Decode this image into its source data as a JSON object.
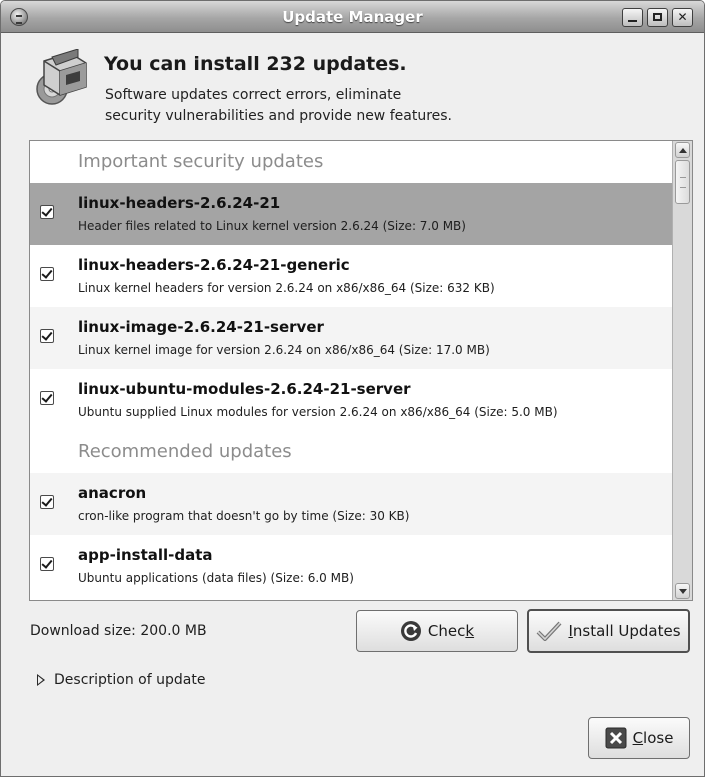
{
  "window": {
    "title": "Update Manager"
  },
  "header": {
    "headline": "You can install 232 updates.",
    "subline_1": "Software updates correct errors, eliminate",
    "subline_2": "security vulnerabilities and provide new features."
  },
  "updates": {
    "sections": [
      {
        "title": "Important security updates",
        "items": [
          {
            "name": "linux-headers-2.6.24-21",
            "description": "Header files related to Linux kernel version 2.6.24 (Size: 7.0 MB)",
            "checked": true,
            "selected": true
          },
          {
            "name": "linux-headers-2.6.24-21-generic",
            "description": "Linux kernel headers for version 2.6.24 on x86/x86_64 (Size: 632 KB)",
            "checked": true
          },
          {
            "name": "linux-image-2.6.24-21-server",
            "description": "Linux kernel image for version 2.6.24 on x86/x86_64 (Size: 17.0 MB)",
            "checked": true
          },
          {
            "name": "linux-ubuntu-modules-2.6.24-21-server",
            "description": "Ubuntu supplied Linux modules for version 2.6.24 on x86/x86_64 (Size: 5.0 MB)",
            "checked": true
          }
        ]
      },
      {
        "title": "Recommended updates",
        "items": [
          {
            "name": "anacron",
            "description": "cron-like program that doesn't go by time (Size: 30 KB)",
            "checked": true
          },
          {
            "name": "app-install-data",
            "description": "Ubuntu applications (data files) (Size: 6.0 MB)",
            "checked": true
          }
        ]
      }
    ]
  },
  "footer": {
    "download_size": "Download size: 200.0 MB",
    "check_label_pre": "Chec",
    "check_label_key": "k",
    "install_label_key": "I",
    "install_label_post": "nstall Updates",
    "description_toggle": "Description of update",
    "close_label_key": "C",
    "close_label_post": "lose"
  },
  "icons": {
    "window_menu": "window-menu-icon",
    "minimize": "minimize-icon",
    "maximize": "maximize-icon",
    "close": "close-icon",
    "header": "package-update-icon",
    "check": "refresh-icon",
    "install": "checkmark-icon",
    "close_button": "close-x-icon",
    "expander": "triangle-right-icon"
  },
  "colors": {
    "selected_row": "#a4a4a4",
    "section_title": "#8c8c8c",
    "window_bg": "#efefef"
  }
}
